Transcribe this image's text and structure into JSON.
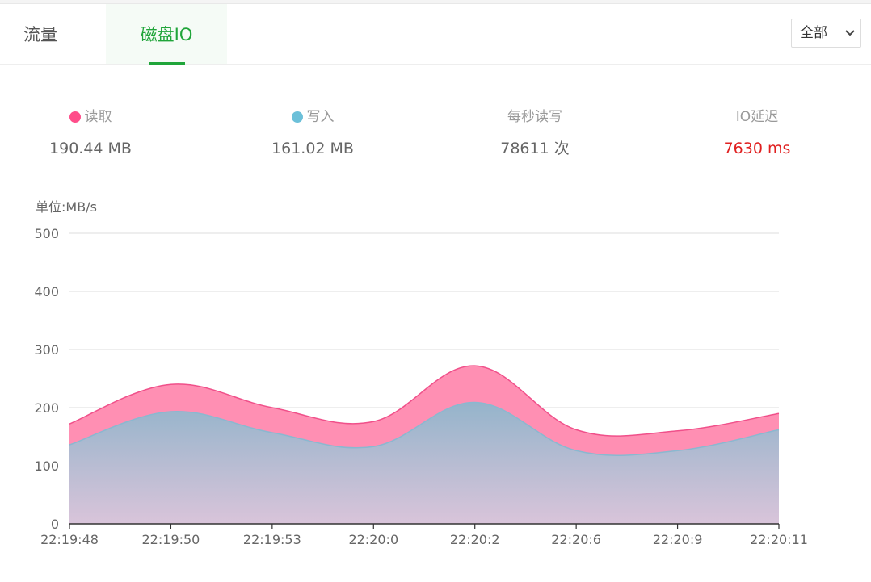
{
  "tabs": [
    {
      "label": "流量"
    },
    {
      "label": "磁盘IO"
    }
  ],
  "filter": {
    "selected": "全部"
  },
  "stats": {
    "read": {
      "label": "读取",
      "value": "190.44 MB",
      "color": "#ff4d8a"
    },
    "write": {
      "label": "写入",
      "value": "161.02 MB",
      "color": "#6cc0d9"
    },
    "iops": {
      "label": "每秒读写",
      "value": "78611 次"
    },
    "latency": {
      "label": "IO延迟",
      "value": "7630 ms",
      "color": "#e02020"
    }
  },
  "chart_data": {
    "type": "area",
    "ylabel": "单位:MB/s",
    "ylim": [
      0,
      500
    ],
    "yticks": [
      0,
      100,
      200,
      300,
      400,
      500
    ],
    "x": [
      "22:19:48",
      "22:19:50",
      "22:19:53",
      "22:20:0",
      "22:20:2",
      "22:20:6",
      "22:20:9",
      "22:20:11"
    ],
    "series": [
      {
        "name": "读取",
        "color": "#ff6d9b",
        "values": [
          172,
          240,
          200,
          176,
          272,
          162,
          160,
          190
        ]
      },
      {
        "name": "写入",
        "color": "#7fb6cc",
        "values": [
          136,
          193,
          157,
          133,
          209,
          126,
          126,
          162
        ]
      }
    ],
    "grid": true
  }
}
